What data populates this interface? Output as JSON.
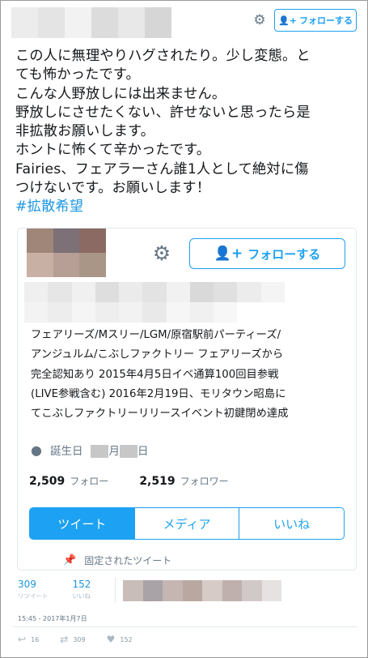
{
  "header": {
    "follow_label": "フォローする",
    "gear_icon": "gear-icon",
    "person_plus_icon": "person-plus-icon"
  },
  "tweet": {
    "lines": [
      "この人に無理やりハグされたり。少し変態。と",
      "ても怖かったです。",
      "こんな人野放しには出来ません。",
      "野放しにさせたくない、許せないと思ったら是",
      "非拡散お願いします。",
      "ホントに怖くて辛かったです。",
      "Fairies、フェアラーさん誰1人として絶対に傷",
      "つけないです。お願いします！"
    ],
    "hashtag": "#拡散希望",
    "hashtag_color": "#1b95e0"
  },
  "card": {
    "follow_label": "フォローする",
    "bio_lines": [
      "フェアリーズ/Mスリー/LGM/原宿駅前パーティーズ/",
      "アンジュルム/こぶしファクトリー フェアリーズから",
      "完全認知あり 2015年4月5日イベ通算100回目参戦",
      "(LIVE参戦含む) 2016年2月19日、モリタウン昭島に",
      "てこぶしファクトリーリリースイベント初鍵閉め達成"
    ],
    "birthday_label": "誕生日",
    "birthday_month_suffix": "月",
    "birthday_day_suffix": "日",
    "following_count": "2,509",
    "following_label": "フォロー",
    "followers_count": "2,519",
    "followers_label": "フォロワー",
    "tabs": [
      {
        "label": "ツイート",
        "active": true
      },
      {
        "label": "メディア",
        "active": false
      },
      {
        "label": "いいね",
        "active": false
      }
    ],
    "pinned_label": "固定されたツイート",
    "accent_color": "#1da1f2"
  },
  "footer": {
    "retweets_count": "309",
    "retweets_label": "リツイート",
    "likes_count": "152",
    "likes_label": "いいね",
    "timestamp": "15:45 - 2017年1月7日",
    "reply_count": "16",
    "retweet_count": "309",
    "like_count": "152"
  }
}
